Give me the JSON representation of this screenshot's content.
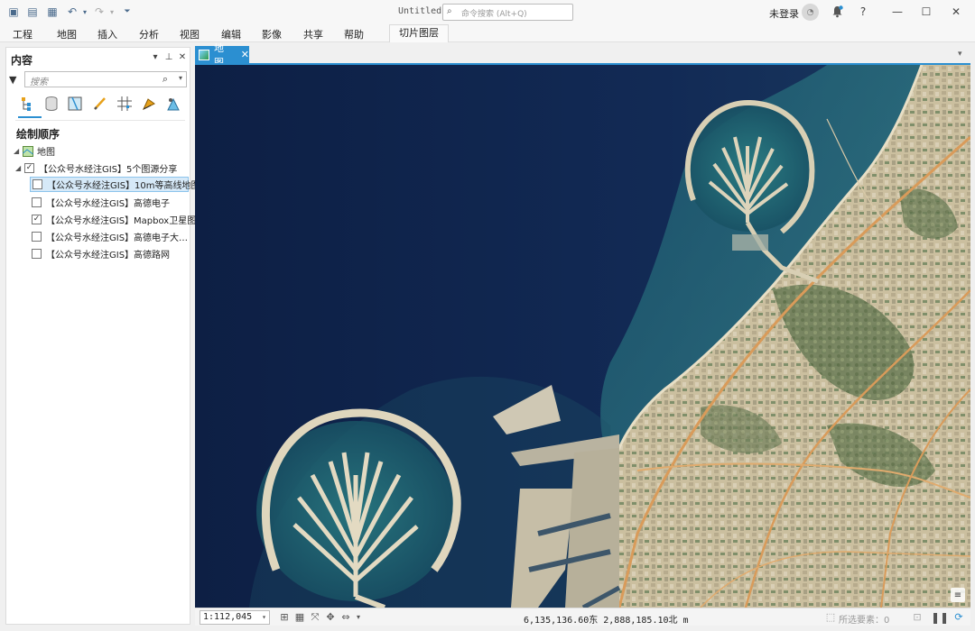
{
  "app": {
    "doc_title": "Untitled",
    "command_search_placeholder": "命令搜索 (Alt+Q)",
    "user_status": "未登录",
    "quick_access_icons": [
      "project-new-icon",
      "open-icon",
      "save-icon",
      "undo-icon",
      "redo-icon",
      "customize-icon"
    ],
    "window_controls": [
      "help-icon",
      "minimize-icon",
      "maximize-icon",
      "close-icon"
    ]
  },
  "ribbon": {
    "tabs": [
      "工程",
      "地图",
      "插入",
      "分析",
      "视图",
      "编辑",
      "影像",
      "共享",
      "帮助"
    ],
    "contextual_tab": "切片图层"
  },
  "contents": {
    "title": "内容",
    "search_placeholder": "搜索",
    "draw_order_label": "绘制顺序",
    "map_node": "地图",
    "group_layer": {
      "label": "【公众号水经注GIS】5个图源分享",
      "checked": true,
      "expanded": true
    },
    "layers": [
      {
        "label": "【公众号水经注GIS】10m等高线地图",
        "checked": false,
        "selected": true
      },
      {
        "label": "【公众号水经注GIS】高德电子",
        "checked": false,
        "selected": false
      },
      {
        "label": "【公众号水经注GIS】Mapbox卫星图",
        "checked": true,
        "selected": false
      },
      {
        "label": "【公众号水经注GIS】高德电子大…",
        "checked": false,
        "selected": false
      },
      {
        "label": "【公众号水经注GIS】高德路网",
        "checked": false,
        "selected": false
      }
    ]
  },
  "map_tab": {
    "label": "地图"
  },
  "status": {
    "scale": "1:112,045",
    "coordinates": "6,135,136.60东  2,888,185.10北 m",
    "selected_features": "所选要素：0"
  },
  "colors": {
    "accent": "#2b8fd1",
    "sea": "#0f2246",
    "shallow": "#2f8c8c",
    "land": "#cdbf9e"
  }
}
